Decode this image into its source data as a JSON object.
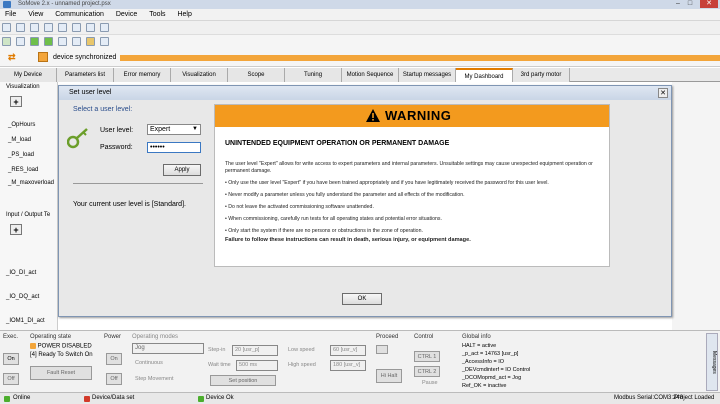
{
  "window": {
    "title": "SoMove 2.x - unnamed project.psx"
  },
  "menu": [
    "File",
    "View",
    "Communication",
    "Device",
    "Tools",
    "Help"
  ],
  "sync_status": "device synchronized",
  "tabs": [
    "My Device",
    "Parameters list",
    "Error memory",
    "Visualization",
    "Scope",
    "Tuning",
    "Motion Sequence",
    "Startup messages",
    "My Dashboard",
    "3rd party motor"
  ],
  "active_tab": "My Dashboard",
  "left_pane": {
    "visualization_label": "Visualization",
    "items": [
      "_OpHours",
      "_M_load",
      "_PS_load",
      "_RES_load",
      "_M_maxoverload"
    ],
    "io_label": "Input / Output Te",
    "io_items": [
      "_IO_DI_act",
      "_IO_DQ_act",
      "_IOM1_DI_act"
    ]
  },
  "dialog": {
    "title": "Set user level",
    "select_header": "Select a user level:",
    "user_level_label": "User level:",
    "user_level_value": "Expert",
    "password_label": "Password:",
    "password_value": "••••••",
    "apply_label": "Apply",
    "current_level_text": "Your current user level is [Standard].",
    "ok_label": "OK"
  },
  "warning": {
    "title": "WARNING",
    "subtitle": "UNINTENDED EQUIPMENT OPERATION OR PERMANENT DAMAGE",
    "intro": "The user level \"Expert\" allows for write access to expert parameters and internal parameters. Unsuitable settings may cause unexpected equipment operation or permanent damage.",
    "bullets": [
      "• Only use the user level \"Expert\" if you have been trained appropriately and if you have legitimately received the password for this user level.",
      "• Never modify a parameter unless you fully understand the parameter and all effects of the modification.",
      "• Do not leave the activated commissioning software unattended.",
      "• When commissioning, carefully run tests for all operating states and potential error situations.",
      "• Only start the system if there are no persons or obstructions in the zone of operation."
    ],
    "final": "Failure to follow these instructions can result in death, serious injury, or equipment damage."
  },
  "bottom": {
    "exec_label": "Exec.",
    "on_label": "On",
    "off_label": "Off",
    "operating_state_label": "Operating state",
    "power_disabled": "POWER DISABLED",
    "ready_state": "[4]  Ready To Switch On",
    "fault_reset": "Fault Reset",
    "power_label": "Power",
    "operating_modes_label": "Operating modes",
    "mode_value": "Jog",
    "continuous": "Continuous",
    "step_movement": "Step Movement",
    "step_in_label": "Step-in",
    "step_in_value": "20 [usr_p]",
    "wait_time_label": "Wait time",
    "wait_time_value": "500 ms",
    "set_position": "Set position",
    "low_speed_label": "Low speed",
    "low_speed_value": "60 [usr_v]",
    "high_speed_label": "High speed",
    "high_speed_value": "180 [usr_v]",
    "proceed_label": "Proceed",
    "hi_halt": "Hi Halt",
    "control_label": "Control",
    "ctrl1": "CTRL 1",
    "ctrl2": "CTRL 2",
    "pause": "Pause",
    "global_info_label": "Global info",
    "global_info": [
      "HALT = active",
      "_p_act = 14763 [usr_p]",
      "_AccessInfo = IO",
      "_DEVcmdinterf = IO Control",
      "_DCOMopmd_act = Jog",
      "Ref_OK = inactive"
    ]
  },
  "status_bar": {
    "online": "Online",
    "device_data_set": "Device/Data set",
    "device_ok": "Device Ok",
    "modbus": "Modbus Serial:COM3:248",
    "project": "Project Loaded",
    "messages_tab": "Messages"
  },
  "colors": {
    "warning_orange": "#f39a1e",
    "sync_bar": "#f3a53a",
    "tab_accent": "#e07b00"
  }
}
